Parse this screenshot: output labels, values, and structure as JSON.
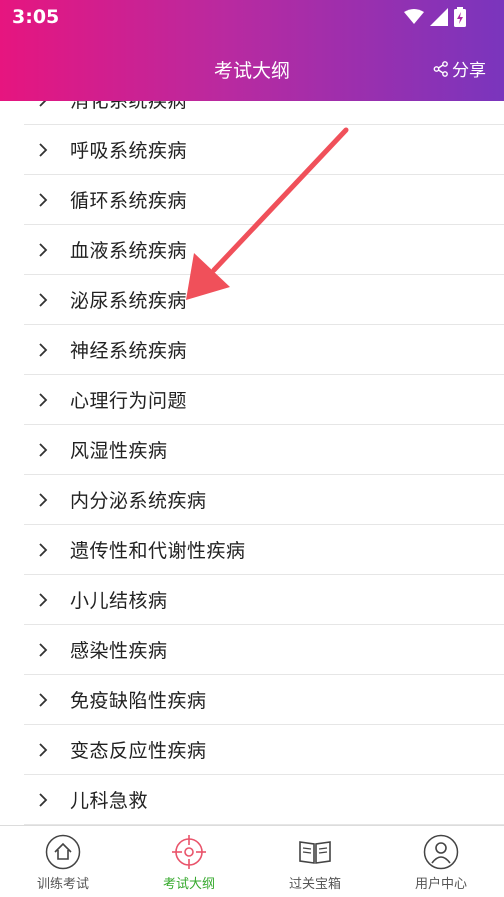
{
  "status": {
    "time": "3:05"
  },
  "header": {
    "title": "考试大纲",
    "share_label": "分享"
  },
  "list": {
    "items": [
      "消化系统疾病",
      "呼吸系统疾病",
      "循环系统疾病",
      "血液系统疾病",
      "泌尿系统疾病",
      "神经系统疾病",
      "心理行为问题",
      "风湿性疾病",
      "内分泌系统疾病",
      "遗传性和代谢性疾病",
      "小儿结核病",
      "感染性疾病",
      "免疫缺陷性疾病",
      "变态反应性疾病",
      "儿科急救"
    ]
  },
  "tabs": [
    {
      "label": "训练考试",
      "icon": "home-icon",
      "active": false
    },
    {
      "label": "考试大纲",
      "icon": "target-icon",
      "active": true
    },
    {
      "label": "过关宝箱",
      "icon": "book-icon",
      "active": false
    },
    {
      "label": "用户中心",
      "icon": "user-icon",
      "active": false
    }
  ],
  "colors": {
    "header_start": "#e6157f",
    "header_end": "#7a35bd",
    "active_tab": "#36a92d",
    "arrow": "#f0505a"
  }
}
